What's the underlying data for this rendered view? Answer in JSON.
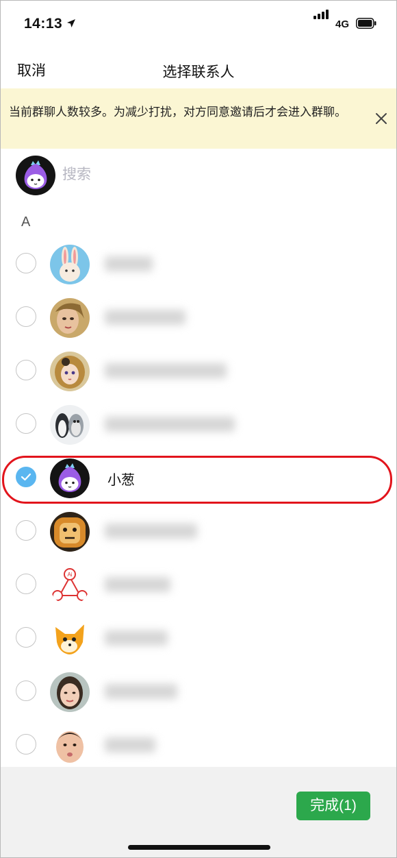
{
  "status_bar": {
    "time": "14:13",
    "network": "4G"
  },
  "nav": {
    "cancel_label": "取消",
    "title": "选择联系人"
  },
  "notice": {
    "text": "当前群聊人数较多。为减少打扰，对方同意邀请后才会进入群聊。"
  },
  "search": {
    "placeholder": "搜索"
  },
  "section_letter": "A",
  "contacts": [
    {
      "name": "",
      "selected": false,
      "avatar": "bunny-avatar"
    },
    {
      "name": "",
      "selected": false,
      "avatar": "doll-avatar"
    },
    {
      "name": "",
      "selected": false,
      "avatar": "anime-girl-avatar"
    },
    {
      "name": "",
      "selected": false,
      "avatar": "penguins-avatar"
    },
    {
      "name": "小葱",
      "selected": true,
      "avatar": "onion-mascot-avatar"
    },
    {
      "name": "",
      "selected": false,
      "avatar": "lion-avatar"
    },
    {
      "name": "",
      "selected": false,
      "avatar": "ai-logo-avatar"
    },
    {
      "name": "",
      "selected": false,
      "avatar": "fox-avatar"
    },
    {
      "name": "",
      "selected": false,
      "avatar": "woman-photo-avatar"
    },
    {
      "name": "",
      "selected": false,
      "avatar": "baby-photo-avatar"
    }
  ],
  "footer": {
    "done_label": "完成(1)"
  },
  "colors": {
    "accent_green": "#2ca84c",
    "check_blue": "#5ab6f0",
    "notice_bg": "#fbf6d3",
    "highlight_red": "#e2141c"
  }
}
